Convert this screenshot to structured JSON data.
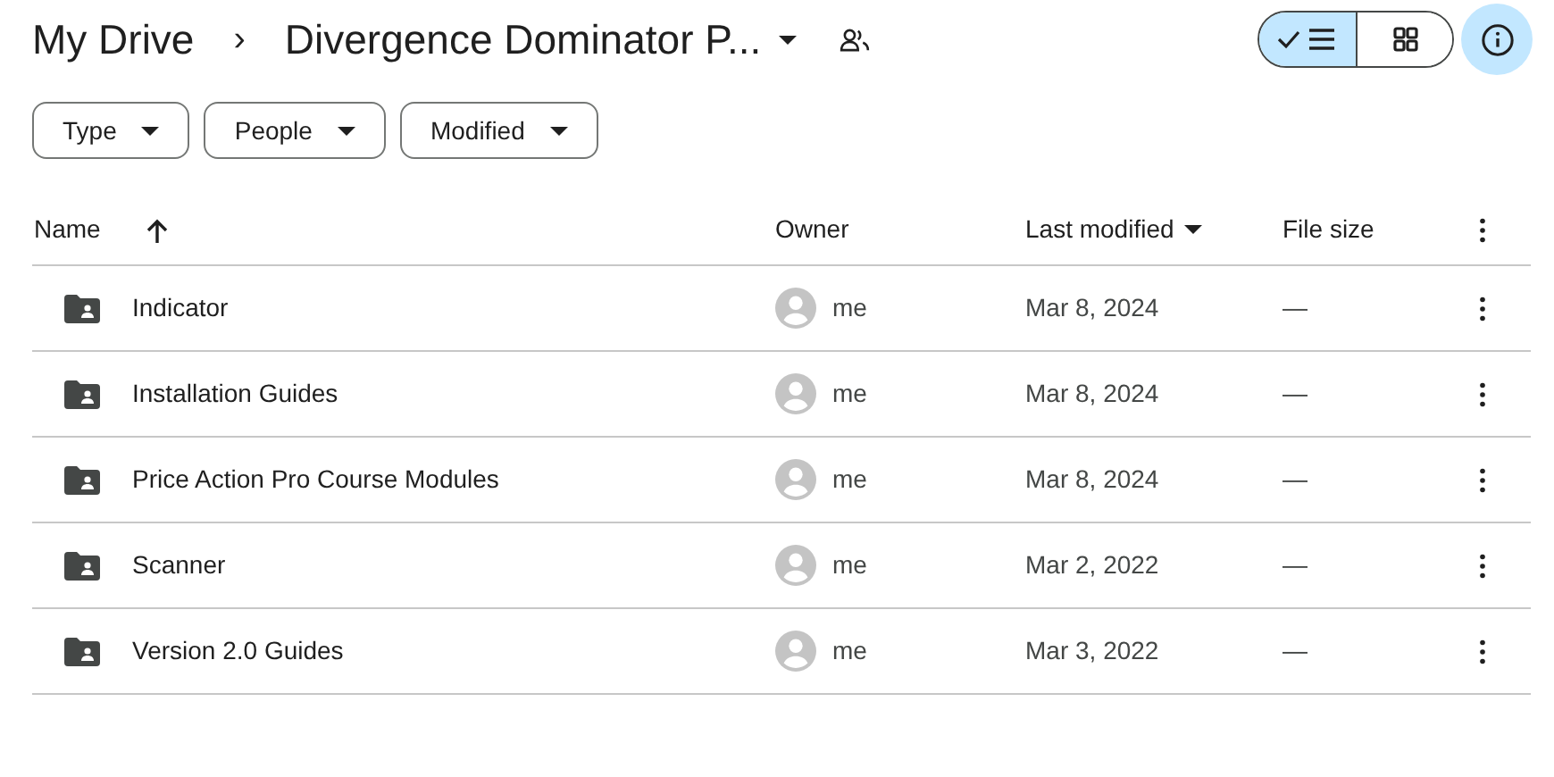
{
  "breadcrumb": {
    "root": "My Drive",
    "separator": "›",
    "current": "Divergence Dominator P..."
  },
  "view_toggle": [
    {
      "kind": "list",
      "selected": true
    },
    {
      "kind": "grid",
      "selected": false
    }
  ],
  "info_button": {
    "selected": true
  },
  "filters": [
    {
      "label": "Type"
    },
    {
      "label": "People"
    },
    {
      "label": "Modified"
    }
  ],
  "columns": [
    {
      "label": "Name",
      "kind": "sort-direction"
    },
    {
      "label": "Owner",
      "kind": "plain"
    },
    {
      "label": "Last modified",
      "kind": "sort-field"
    },
    {
      "label": "File size",
      "kind": "plain"
    }
  ],
  "rows": [
    {
      "name": "Indicator",
      "owner": "me",
      "modified": "Mar 8, 2024",
      "size": "—"
    },
    {
      "name": "Installation Guides",
      "owner": "me",
      "modified": "Mar 8, 2024",
      "size": "—"
    },
    {
      "name": "Price Action Pro Course Modules",
      "owner": "me",
      "modified": "Mar 8, 2024",
      "size": "—"
    },
    {
      "name": "Scanner",
      "owner": "me",
      "modified": "Mar 2, 2022",
      "size": "—"
    },
    {
      "name": "Version 2.0 Guides",
      "owner": "me",
      "modified": "Mar 3, 2022",
      "size": "—"
    }
  ]
}
